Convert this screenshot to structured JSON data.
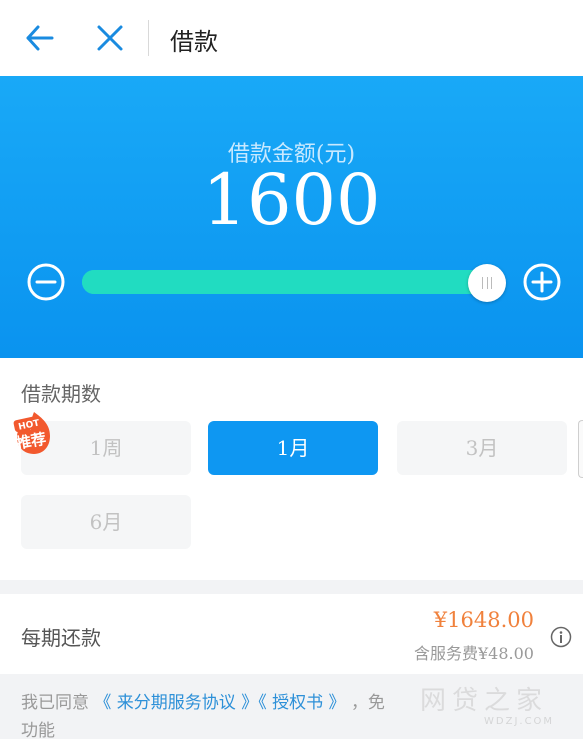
{
  "header": {
    "title": "借款",
    "back_icon": "arrow-left-icon",
    "close_icon": "close-icon"
  },
  "amount": {
    "label": "借款金额(元)",
    "value": "1600",
    "slider_fraction": 1.0
  },
  "term": {
    "title": "借款期数",
    "hot_badge": "推荐",
    "options": [
      {
        "label": "1周",
        "selected": false
      },
      {
        "label": "1月",
        "selected": true
      },
      {
        "label": "3月",
        "selected": false
      },
      {
        "label": "6月",
        "selected": false
      }
    ]
  },
  "repayment": {
    "label": "每期还款",
    "amount": "¥1648.00",
    "fee": "含服务费¥48.00"
  },
  "agreement": {
    "prefix": "我已同意",
    "link1": "《 来分期服务协议 》",
    "link2": "《 授权书 》",
    "suffix": "，免",
    "line2": "功能"
  },
  "watermark": {
    "text": "网贷之家",
    "sub": "WDZJ.COM"
  },
  "colors": {
    "primary": "#0e97f2",
    "slider": "#21dcc1",
    "accent_orange": "#f0813c",
    "link": "#2d90d8"
  }
}
